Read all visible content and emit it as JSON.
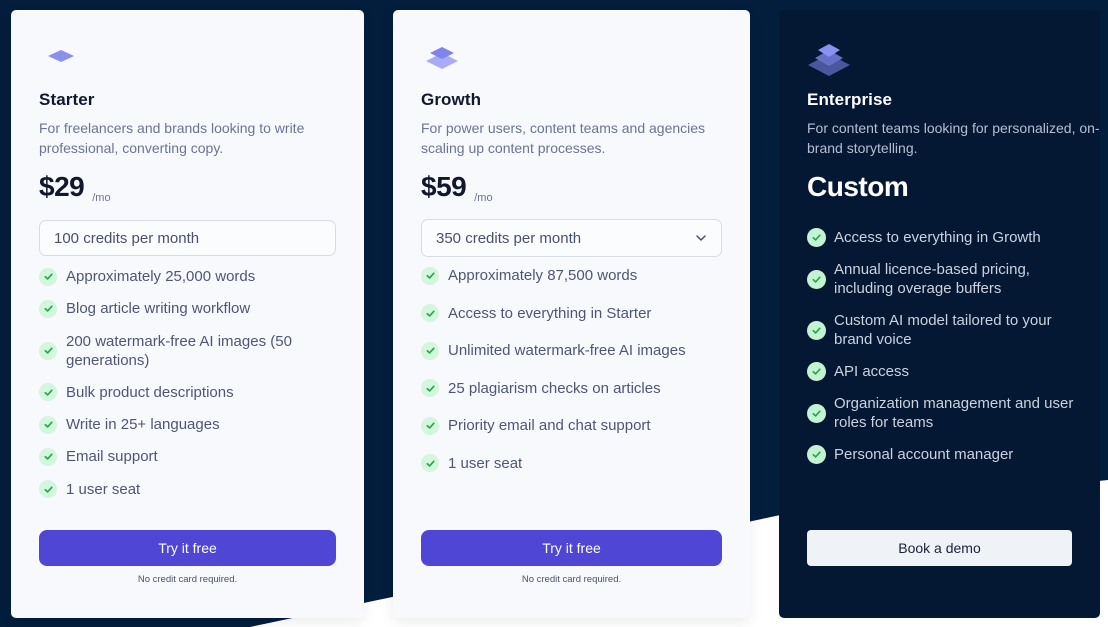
{
  "colors": {
    "page_background": "#031d3d",
    "card_background": "#f8f9fd",
    "enterprise_background": "#041833",
    "primary_button": "#4f46d5",
    "check_badge": "#d3f6dc",
    "check_mark": "#22a84a",
    "icon_accent": "#7f86f0"
  },
  "plans": [
    {
      "id": "starter",
      "icon": "single-layer-icon",
      "name": "Starter",
      "description": "For freelancers and brands looking to write professional, converting copy.",
      "price": "$29",
      "period": "/mo",
      "credits": "100 credits per month",
      "credits_has_dropdown": false,
      "features": [
        "Approximately 25,000 words",
        "Blog article writing workflow",
        "200 watermark-free AI images (50 generations)",
        "Bulk product descriptions",
        "Write in 25+ languages",
        "Email support",
        "1 user seat"
      ],
      "cta_label": "Try it free",
      "cta_note": "No credit card required."
    },
    {
      "id": "growth",
      "icon": "double-layer-icon",
      "name": "Growth",
      "description": "For power users, content teams and agencies scaling up content processes.",
      "price": "$59",
      "period": "/mo",
      "credits": "350 credits per month",
      "credits_has_dropdown": true,
      "features": [
        "Approximately 87,500 words",
        "Access to everything in Starter",
        "Unlimited watermark-free AI images",
        "25 plagiarism checks on articles",
        "Priority email and chat support",
        "1 user seat"
      ],
      "cta_label": "Try it free",
      "cta_note": "No credit card required."
    },
    {
      "id": "enterprise",
      "icon": "triple-layer-icon",
      "name": "Enterprise",
      "description": "For content teams looking for personalized, on-brand storytelling.",
      "price": "Custom",
      "features": [
        "Access to everything in Growth",
        "Annual licence-based pricing, including overage buffers",
        "Custom AI model tailored to your brand voice",
        "API access",
        "Organization management and user roles for teams",
        "Personal account manager"
      ],
      "cta_label": "Book a demo"
    }
  ]
}
